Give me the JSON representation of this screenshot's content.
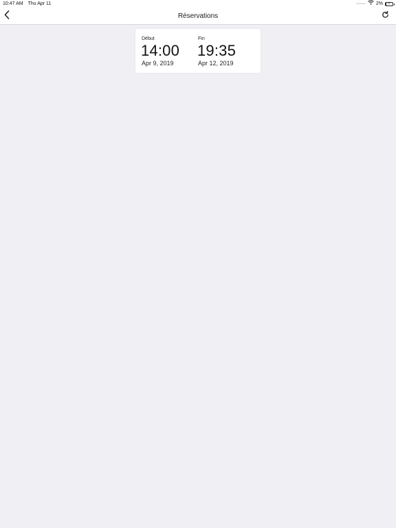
{
  "status_bar": {
    "time": "10:47 AM",
    "date": "Thu Apr 11",
    "battery_percent_label": "2%",
    "battery_level": 0.02,
    "bolt": "⚡"
  },
  "navbar": {
    "title": "Réservations",
    "back_icon": "chevron-left-icon",
    "refresh_icon": "refresh-icon"
  },
  "reservation": {
    "start": {
      "label": "Début",
      "time": "14:00",
      "date": "Apr 9, 2019"
    },
    "end": {
      "label": "Fin",
      "time": "19:35",
      "date": "Apr 12, 2019"
    }
  }
}
